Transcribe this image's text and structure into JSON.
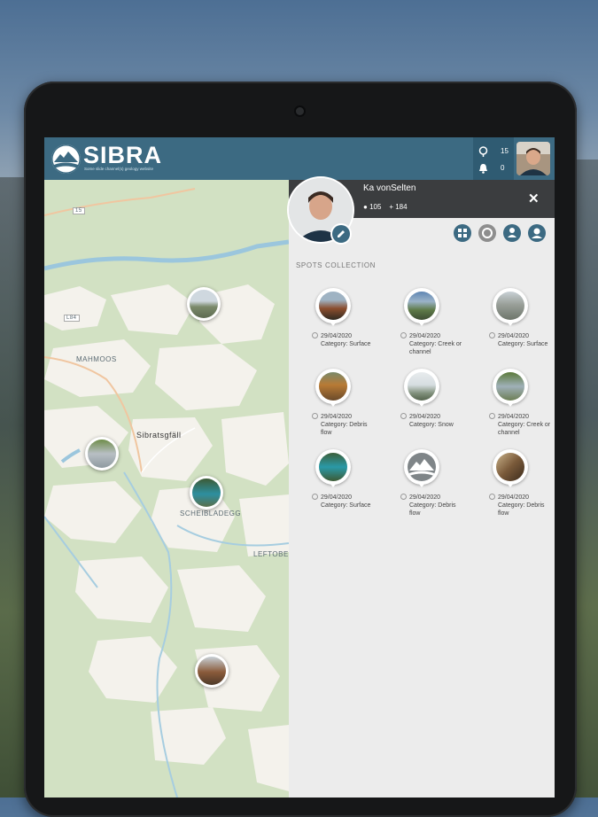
{
  "app": {
    "title": "SIBRA",
    "subtitle": "Some slide channel(s) geology website"
  },
  "counters": {
    "spots": "15",
    "notifications": "0"
  },
  "map": {
    "labels": {
      "mahmoos": "MAHMOOS",
      "sibratsgfall": "Sibratsgfäll",
      "scheibladegg": "SCHEIBLADEGG",
      "leftobel": "LEFTOBE",
      "road_15": "15",
      "road_l129": "L129",
      "road_l84": "L84"
    }
  },
  "profile": {
    "name": "Ka vonSelten",
    "followers": "105",
    "spots_count": "184"
  },
  "panel": {
    "section_title": "SPOTS COLLECTION"
  },
  "spots": [
    {
      "date": "29/04/2020",
      "category": "Category: Surface",
      "thumb": "brown-slope"
    },
    {
      "date": "29/04/2020",
      "category": "Category: Creek or channel",
      "thumb": "green-valley"
    },
    {
      "date": "29/04/2020",
      "category": "Category: Surface",
      "thumb": "rock-slope"
    },
    {
      "date": "29/04/2020",
      "category": "Category: Debris flow",
      "thumb": "orange-forest"
    },
    {
      "date": "29/04/2020",
      "category": "Category: Snow",
      "thumb": "snow-field"
    },
    {
      "date": "29/04/2020",
      "category": "Category: Creek or channel",
      "thumb": "creek-stones"
    },
    {
      "date": "29/04/2020",
      "category": "Category: Surface",
      "thumb": "turquoise-river"
    },
    {
      "date": "29/04/2020",
      "category": "Category: Debris flow",
      "thumb": "placeholder-mountain"
    },
    {
      "date": "29/04/2020",
      "category": "Category: Debris flow",
      "thumb": "debris-closeup"
    }
  ],
  "colors": {
    "header": "#3c6a82",
    "header_dark": "#2f5b72",
    "profile_bar": "#3b3d3f",
    "panel_bg": "#ececec",
    "map_forest": "#d2e1c3",
    "map_open": "#f2f0ea"
  },
  "icons": {
    "search": "search-icon",
    "bell": "bell-icon",
    "edit": "pencil-icon",
    "close": "close-icon",
    "grid": "grid-icon",
    "settings": "gear-icon",
    "user": "user-icon",
    "account": "account-icon"
  }
}
